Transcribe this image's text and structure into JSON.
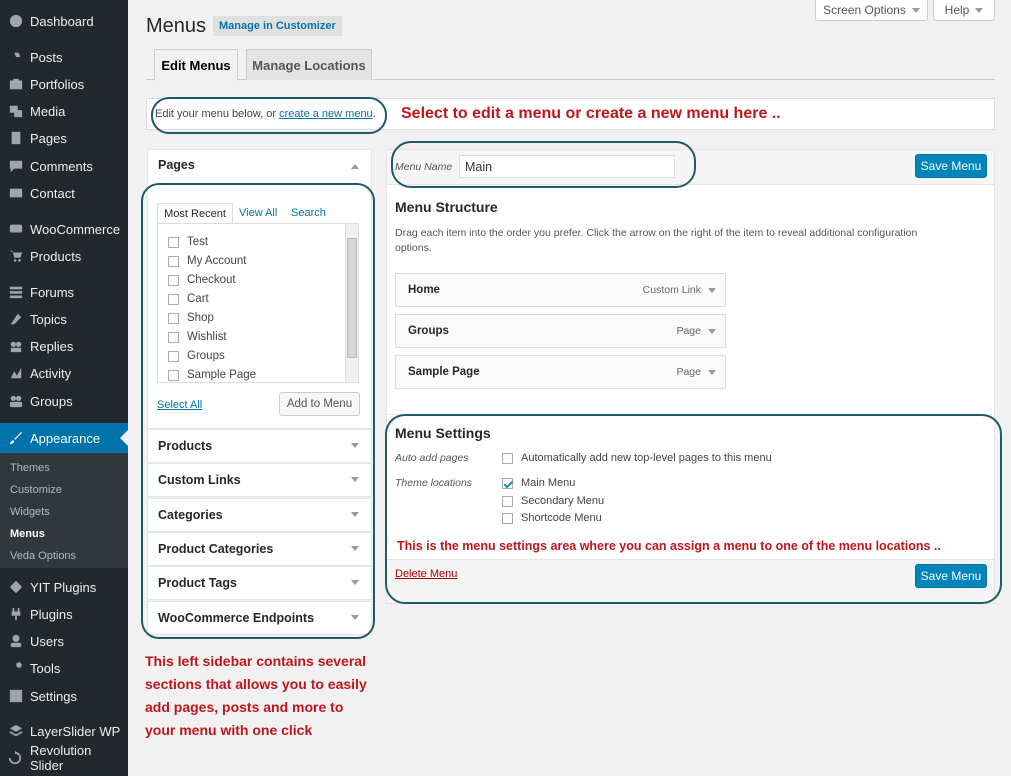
{
  "sidebar": {
    "items": [
      {
        "label": "Dashboard",
        "icon": "dashboard-icon"
      },
      {
        "label": "Posts",
        "icon": "pin-icon"
      },
      {
        "label": "Portfolios",
        "icon": "portfolio-icon"
      },
      {
        "label": "Media",
        "icon": "media-icon"
      },
      {
        "label": "Pages",
        "icon": "pages-icon"
      },
      {
        "label": "Comments",
        "icon": "comment-icon"
      },
      {
        "label": "Contact",
        "icon": "mail-icon"
      },
      {
        "label": "WooCommerce",
        "icon": "woocommerce-icon"
      },
      {
        "label": "Products",
        "icon": "cart-icon"
      },
      {
        "label": "Forums",
        "icon": "forums-icon"
      },
      {
        "label": "Topics",
        "icon": "topics-icon"
      },
      {
        "label": "Replies",
        "icon": "replies-icon"
      },
      {
        "label": "Activity",
        "icon": "activity-icon"
      },
      {
        "label": "Groups",
        "icon": "groups-icon"
      },
      {
        "label": "Appearance",
        "icon": "brush-icon"
      },
      {
        "label": "YIT Plugins",
        "icon": "yit-icon"
      },
      {
        "label": "Plugins",
        "icon": "plugin-icon"
      },
      {
        "label": "Users",
        "icon": "users-icon"
      },
      {
        "label": "Tools",
        "icon": "wrench-icon"
      },
      {
        "label": "Settings",
        "icon": "settings-icon"
      },
      {
        "label": "LayerSlider WP",
        "icon": "layers-icon"
      },
      {
        "label": "Revolution Slider",
        "icon": "refresh-icon"
      }
    ],
    "submenu": [
      "Themes",
      "Customize",
      "Widgets",
      "Menus",
      "Veda Options"
    ]
  },
  "header": {
    "title": "Menus",
    "customizer_link": "Manage in Customizer",
    "screen_options": "Screen Options",
    "help": "Help"
  },
  "tabs": [
    "Edit Menus",
    "Manage Locations"
  ],
  "edit_notice": {
    "text": "Edit your menu below, or ",
    "link": "create a new menu",
    "after": "."
  },
  "annotations": {
    "top": "Select to edit a menu or create a new menu here ..",
    "settings": "This is the menu settings area where you can assign a menu to one of the menu locations ..",
    "sidebar": [
      "This left sidebar contains several",
      "sections that allows you to easily",
      "add pages, posts and more to",
      "your menu with one click"
    ]
  },
  "pages_panel": {
    "title": "Pages",
    "tabs": [
      "Most Recent",
      "View All",
      "Search"
    ],
    "items": [
      "Test",
      "My Account",
      "Checkout",
      "Cart",
      "Shop",
      "Wishlist",
      "Groups",
      "Sample Page"
    ],
    "select_all": "Select All",
    "add_button": "Add to Menu"
  },
  "accordion": [
    "Products",
    "Custom Links",
    "Categories",
    "Product Categories",
    "Product Tags",
    "WooCommerce Endpoints"
  ],
  "menu_editor": {
    "name_label": "Menu Name",
    "name_value": "Main",
    "save": "Save Menu",
    "structure_title": "Menu Structure",
    "structure_desc_1": "Drag each item into the order you prefer. Click the arrow on the right of the item to reveal additional configuration",
    "structure_desc_2": "options.",
    "items": [
      {
        "title": "Home",
        "type": "Custom Link"
      },
      {
        "title": "Groups",
        "type": "Page"
      },
      {
        "title": "Sample Page",
        "type": "Page"
      }
    ],
    "settings_title": "Menu Settings",
    "auto_add_label": "Auto add pages",
    "auto_add_option": "Automatically add new top-level pages to this menu",
    "locations_label": "Theme locations",
    "locations": [
      {
        "label": "Main Menu",
        "checked": true
      },
      {
        "label": "Secondary Menu",
        "checked": false
      },
      {
        "label": "Shortcode Menu",
        "checked": false
      }
    ],
    "delete": "Delete Menu"
  },
  "colors": {
    "accent": "#0073aa",
    "annotation_red": "#c0161b",
    "annotation_border": "#1f5a68",
    "sidebar_bg": "#23282d"
  }
}
